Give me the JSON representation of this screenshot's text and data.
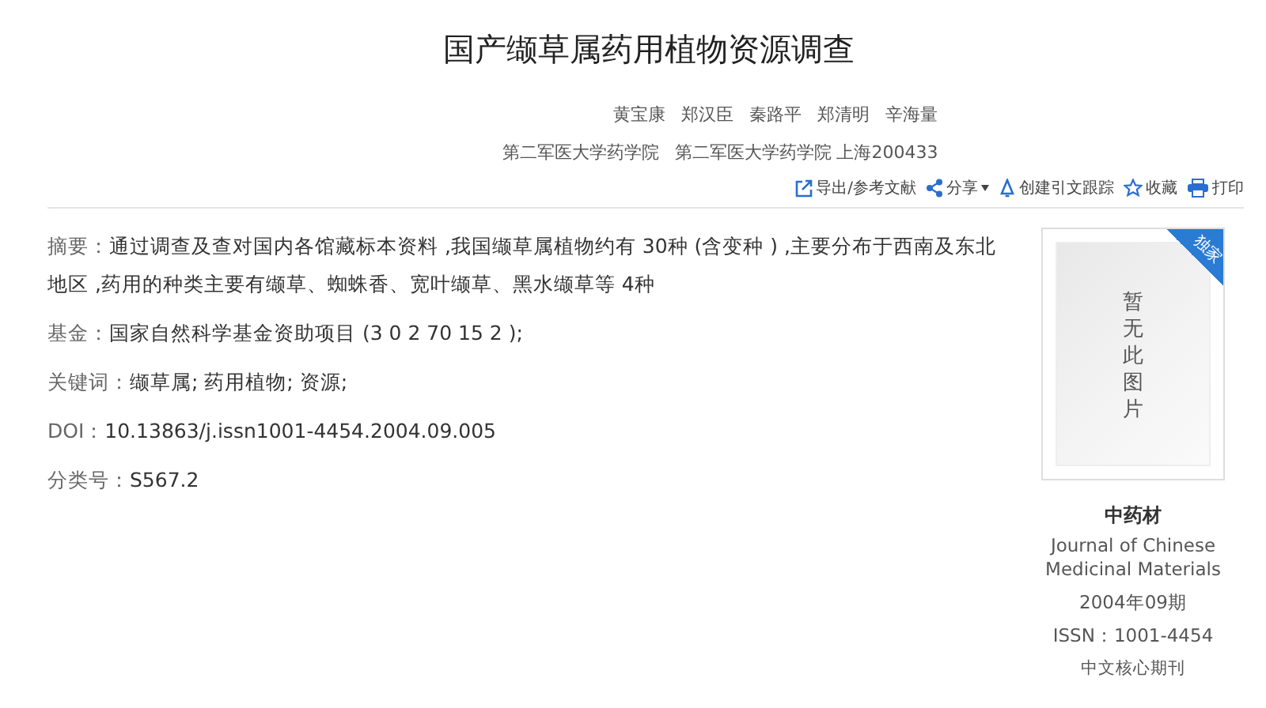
{
  "title": "国产缬草属药用植物资源调查",
  "authors": [
    "黄宝康",
    "郑汉臣",
    "秦路平",
    "郑清明",
    "辛海量"
  ],
  "affiliations": [
    "第二军医大学药学院",
    "第二军医大学药学院 上海200433"
  ],
  "toolbar": [
    {
      "kind": "export",
      "label": "导出/参考文献"
    },
    {
      "kind": "share",
      "label": "分享"
    },
    {
      "kind": "alert",
      "label": "创建引文跟踪"
    },
    {
      "kind": "favorite",
      "label": "收藏"
    },
    {
      "kind": "print",
      "label": "打印"
    }
  ],
  "fields": [
    {
      "label": "摘要：",
      "value": "通过调查及查对国内各馆藏标本资料 ,我国缬草属植物约有 30种 (含变种 ) ,主要分布于西南及东北地区 ,药用的种类主要有缬草、蜘蛛香、宽叶缬草、黑水缬草等 4种"
    },
    {
      "label": "基金：",
      "value": "国家自然科学基金资助项目 (3 0 2 70 15 2 );"
    },
    {
      "label": "关键词：",
      "value": "缬草属; 药用植物; 资源;"
    },
    {
      "label": "DOI：",
      "value": "10.13863/j.issn1001-4454.2004.09.005"
    },
    {
      "label": "分类号：",
      "value": "S567.2"
    }
  ],
  "journal": {
    "cover_text": "暂无此图片",
    "ribbon": "独家",
    "name": "中药材",
    "name_en": "Journal of Chinese Medicinal Materials",
    "issue": "2004年09期",
    "issn": "ISSN：1001-4454",
    "tag": "中文核心期刊"
  }
}
